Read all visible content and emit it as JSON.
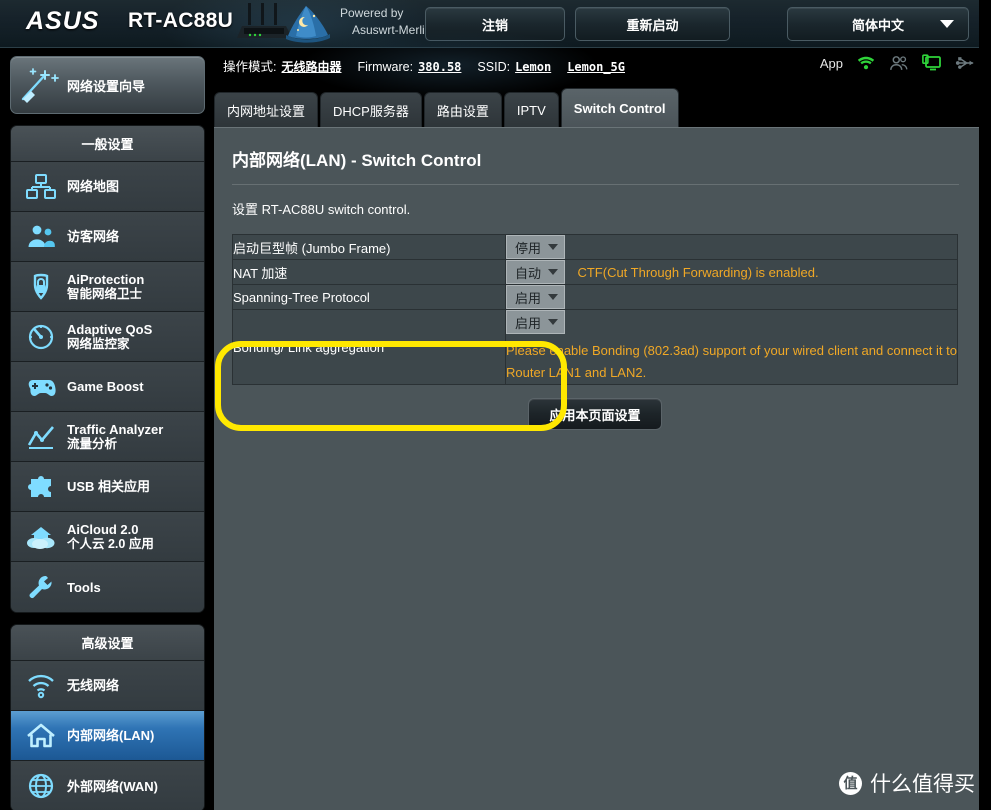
{
  "header": {
    "brand": "/5U5",
    "brand_text": "ASUS",
    "model": "RT-AC88U",
    "powered_by_line1": "Powered by",
    "powered_by_line2": "Asuswrt-Merlin",
    "logout_label": "注销",
    "reboot_label": "重新启动",
    "language_label": "简体中文",
    "router_icon": "router-antennas-icon",
    "wizard_hat_icon": "wizard-hat-icon",
    "caret_icon": "chevron-down-icon"
  },
  "infobar": {
    "operation_mode_label": "操作模式:",
    "operation_mode_value": "无线路由器",
    "firmware_label": "Firmware:",
    "firmware_value": "380.58",
    "ssid_label": "SSID:",
    "ssid_24": "Lemon",
    "ssid_5g": "Lemon_5G",
    "app_label": "App",
    "icons": [
      {
        "name": "wifi-icon",
        "color": "#2fd43a"
      },
      {
        "name": "guest-users-icon",
        "color": "#6d7a7f"
      },
      {
        "name": "connected-clients-icon",
        "color": "#2fd43a"
      },
      {
        "name": "usb-icon",
        "color": "#6d7a7f"
      }
    ]
  },
  "sidebar": {
    "wizard": {
      "label": "网络设置向导",
      "icon": "magic-wand-icon"
    },
    "general_group": {
      "header": "一般设置",
      "items": [
        {
          "label": "网络地图",
          "sub": "",
          "icon": "network-map-icon",
          "active": false
        },
        {
          "label": "访客网络",
          "sub": "",
          "icon": "guest-network-icon",
          "active": false
        },
        {
          "label": "AiProtection",
          "sub": "智能网络卫士",
          "icon": "shield-lock-icon",
          "active": false
        },
        {
          "label": "Adaptive QoS",
          "sub": "网络监控家",
          "icon": "speedometer-icon",
          "active": false
        },
        {
          "label": "Game Boost",
          "sub": "",
          "icon": "gamepad-icon",
          "active": false
        },
        {
          "label": "Traffic Analyzer",
          "sub": "流量分析",
          "icon": "chart-line-icon",
          "active": false
        },
        {
          "label": "USB 相关应用",
          "sub": "",
          "icon": "puzzle-piece-icon",
          "active": false
        },
        {
          "label": "AiCloud 2.0",
          "sub": "个人云 2.0 应用",
          "icon": "cloud-home-icon",
          "active": false
        },
        {
          "label": "Tools",
          "sub": "",
          "icon": "wrench-icon",
          "active": false
        }
      ]
    },
    "advanced_group": {
      "header": "高级设置",
      "items": [
        {
          "label": "无线网络",
          "sub": "",
          "icon": "wifi-signal-icon",
          "active": false
        },
        {
          "label": "内部网络(LAN)",
          "sub": "",
          "icon": "home-icon",
          "active": true
        },
        {
          "label": "外部网络(WAN)",
          "sub": "",
          "icon": "globe-icon",
          "active": false
        }
      ]
    }
  },
  "main": {
    "tabs": [
      {
        "label": "内网地址设置",
        "active": false
      },
      {
        "label": "DHCP服务器",
        "active": false
      },
      {
        "label": "路由设置",
        "active": false
      },
      {
        "label": "IPTV",
        "active": false
      },
      {
        "label": "Switch Control",
        "active": true
      }
    ],
    "page_title": "内部网络(LAN) - Switch Control",
    "page_desc": "设置 RT-AC88U switch control.",
    "rows": [
      {
        "label": "启动巨型帧 (Jumbo Frame)",
        "select_value": "停用",
        "hint": "",
        "hint_block": ""
      },
      {
        "label": "NAT 加速",
        "select_value": "自动",
        "hint": "CTF(Cut Through Forwarding) is enabled.",
        "hint_block": ""
      },
      {
        "label": "Spanning-Tree Protocol",
        "select_value": "启用",
        "hint": "",
        "hint_block": ""
      },
      {
        "label": "Bonding/ Link aggregation",
        "select_value": "启用",
        "hint": "",
        "hint_block": "Please enable Bonding (802.3ad) support of your wired client and connect it to Router LAN1 and LAN2."
      }
    ],
    "apply_label": "应用本页面设置"
  },
  "annotation": {
    "highlight_color": "#ffe800",
    "shape": "rounded-rectangle-outline"
  },
  "watermark": {
    "badge": "值",
    "text": "什么值得买"
  }
}
